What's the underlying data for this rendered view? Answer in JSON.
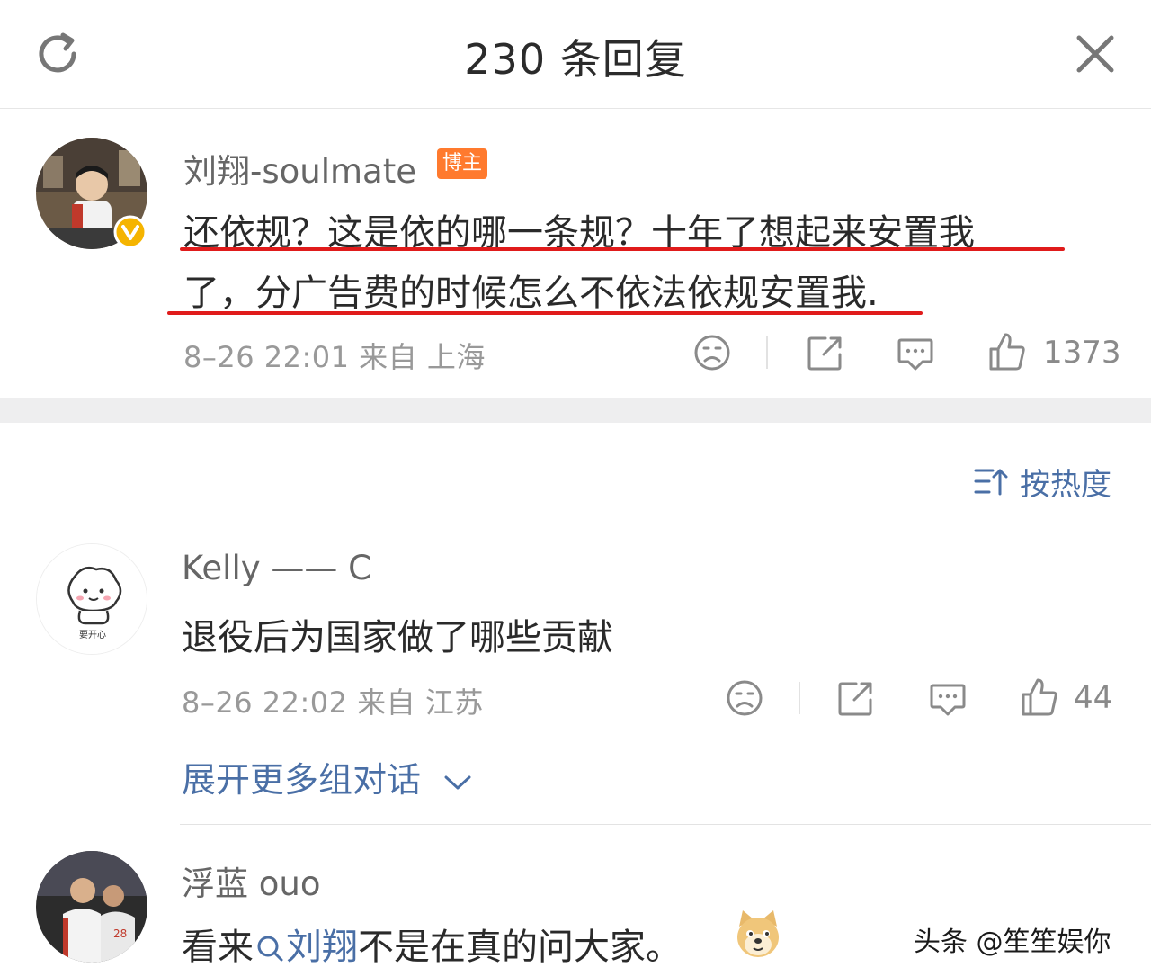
{
  "header": {
    "title": "230 条回复"
  },
  "main_comment": {
    "username": "刘翔-soulmate",
    "badge": "博主",
    "line1": "还依规？这是依的哪一条规？十年了想起来安置我",
    "line2": "了，分广告费的时候怎么不依法依规安置我.",
    "meta": "8–26 22:01  来自 上海",
    "likes": "1373"
  },
  "sort": {
    "label": "按热度"
  },
  "reply1": {
    "username": "Kelly —— C",
    "text": "退役后为国家做了哪些贡献",
    "meta": "8–26 22:02  来自 江苏",
    "likes": "44",
    "avatar_caption": "要开心",
    "expand_label": "展开更多组对话"
  },
  "reply2": {
    "username": "浮蓝 ouo",
    "text_prefix": "看来",
    "link_text": "刘翔",
    "text_suffix": "不是在真的问大家。"
  },
  "watermark": "头条 @笙笙娱你",
  "colors": {
    "link": "#4a6fa6",
    "badge": "#ff7a2e",
    "underline": "#e01b1b",
    "verified": "#f5b400"
  }
}
